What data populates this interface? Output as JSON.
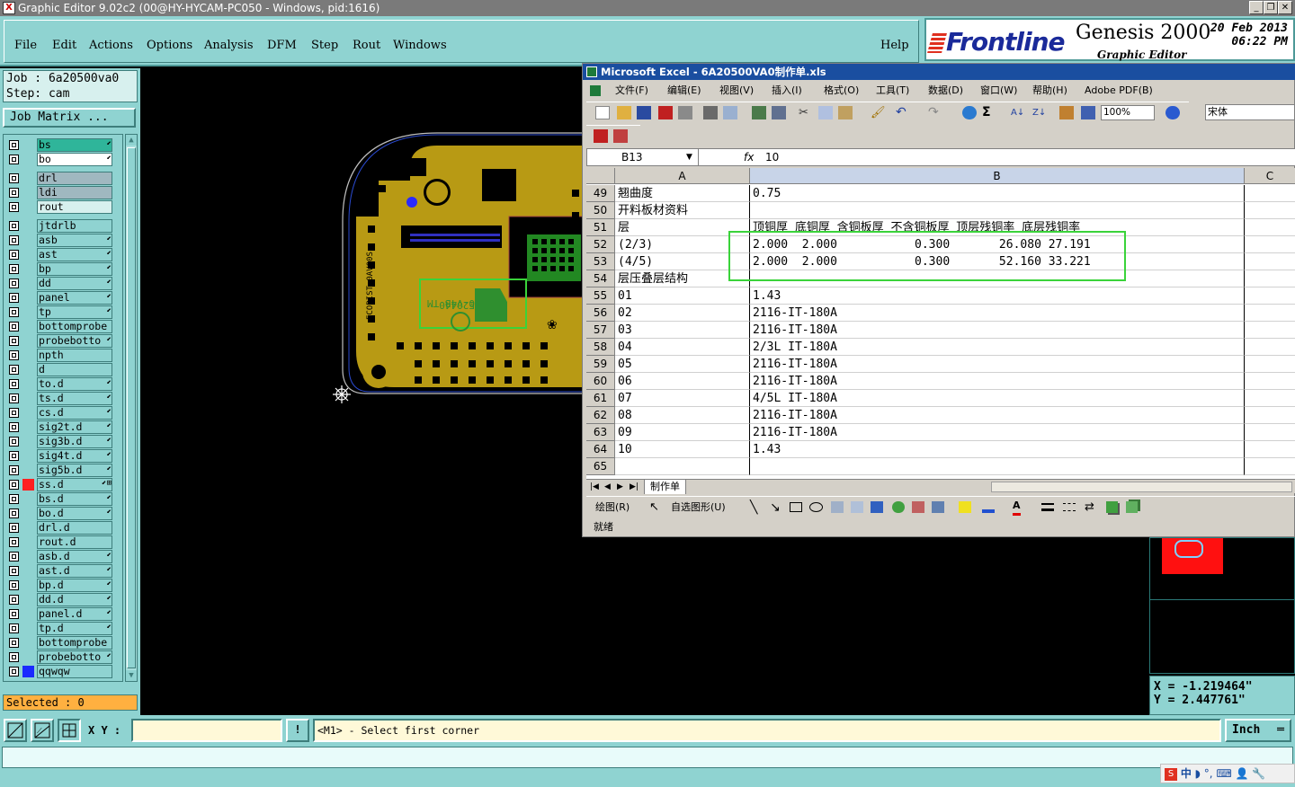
{
  "window": {
    "title": "Graphic Editor 9.02c2 (00@HY-HYCAM-PC050 - Windows, pid:1616)"
  },
  "menu": [
    {
      "label": "File"
    },
    {
      "label": "Edit"
    },
    {
      "label": "Actions"
    },
    {
      "label": "Options"
    },
    {
      "label": "Analysis"
    },
    {
      "label": "DFM"
    },
    {
      "label": "Step"
    },
    {
      "label": "Rout"
    },
    {
      "label": "Windows"
    },
    {
      "label": "Help"
    }
  ],
  "brand": {
    "logo": "Frontline",
    "product": "Genesis 2000",
    "subtitle": "Graphic Editor",
    "date": "20 Feb 2013",
    "time": "06:22 PM"
  },
  "job": {
    "job_line": "Job : 6a20500va0",
    "step_line": "Step: cam",
    "matrix_button": "Job Matrix ...",
    "selected": "Selected : 0"
  },
  "layers": [
    {
      "name": "bs",
      "color": "#2fb59a",
      "tag": "⬋"
    },
    {
      "name": "bo",
      "color": "#ffffff",
      "tag": "⬋"
    },
    {
      "name": "drl",
      "color": "#a0b8c0",
      "tag": ""
    },
    {
      "name": "ldi",
      "color": "#a0b8c0",
      "tag": ""
    },
    {
      "name": "rout",
      "color": "#d7f0ee",
      "tag": ""
    },
    {
      "name": "jtdrlb",
      "color": "",
      "tag": ""
    },
    {
      "name": "asb",
      "color": "",
      "tag": "⬋"
    },
    {
      "name": "ast",
      "color": "",
      "tag": "⬋"
    },
    {
      "name": "bp",
      "color": "",
      "tag": "⬋"
    },
    {
      "name": "dd",
      "color": "",
      "tag": "⬋"
    },
    {
      "name": "panel",
      "color": "",
      "tag": "⬋"
    },
    {
      "name": "tp",
      "color": "",
      "tag": "⬋"
    },
    {
      "name": "bottomprobe",
      "color": "",
      "tag": ""
    },
    {
      "name": "probebotto",
      "color": "",
      "tag": "⬋"
    },
    {
      "name": "npth",
      "color": "",
      "tag": ""
    },
    {
      "name": "d",
      "color": "",
      "tag": ""
    },
    {
      "name": "to.d",
      "color": "",
      "tag": "⬋"
    },
    {
      "name": "ts.d",
      "color": "",
      "tag": "⬋"
    },
    {
      "name": "cs.d",
      "color": "",
      "tag": "⬋"
    },
    {
      "name": "sig2t.d",
      "color": "",
      "tag": "⬋"
    },
    {
      "name": "sig3b.d",
      "color": "",
      "tag": "⬋"
    },
    {
      "name": "sig4t.d",
      "color": "",
      "tag": "⬋"
    },
    {
      "name": "sig5b.d",
      "color": "",
      "tag": "⬋"
    },
    {
      "name": "ss.d",
      "color": "",
      "tag": "⬋⊞",
      "swatch": "#ff2020"
    },
    {
      "name": "bs.d",
      "color": "",
      "tag": "⬋"
    },
    {
      "name": "bo.d",
      "color": "",
      "tag": "⬋"
    },
    {
      "name": "drl.d",
      "color": "",
      "tag": ""
    },
    {
      "name": "rout.d",
      "color": "",
      "tag": ""
    },
    {
      "name": "asb.d",
      "color": "",
      "tag": "⬋"
    },
    {
      "name": "ast.d",
      "color": "",
      "tag": "⬋"
    },
    {
      "name": "bp.d",
      "color": "",
      "tag": "⬋"
    },
    {
      "name": "dd.d",
      "color": "",
      "tag": "⬋"
    },
    {
      "name": "panel.d",
      "color": "",
      "tag": "⬋"
    },
    {
      "name": "tp.d",
      "color": "",
      "tag": "⬋"
    },
    {
      "name": "bottomprobe",
      "color": "",
      "tag": ""
    },
    {
      "name": "probebotto",
      "color": "",
      "tag": "⬋"
    },
    {
      "name": "qqwqw",
      "color": "",
      "tag": "",
      "swatch": "#1a2aff"
    }
  ],
  "excel": {
    "title": "Microsoft Excel - 6A20500VA0制作单.xls",
    "menu": [
      "文件(F)",
      "编辑(E)",
      "视图(V)",
      "插入(I)",
      "格式(O)",
      "工具(T)",
      "数据(D)",
      "窗口(W)",
      "帮助(H)",
      "Adobe PDF(B)"
    ],
    "zoom": "100%",
    "font": "宋体",
    "name_box": "B13",
    "fx": "fx",
    "formula": "10",
    "columns": [
      "A",
      "B",
      "C"
    ],
    "rows": [
      {
        "num": "49",
        "a": "翘曲度",
        "b": "0.75"
      },
      {
        "num": "50",
        "a": "开料板材资料",
        "b": ""
      },
      {
        "num": "51",
        "a": "层",
        "b": "顶铜厚 底铜厚 含铜板厚 不含铜板厚 顶层残铜率 底层残铜率"
      },
      {
        "num": "52",
        "a": "(2/3)",
        "b": "2.000  2.000           0.300       26.080 27.191"
      },
      {
        "num": "53",
        "a": "(4/5)",
        "b": "2.000  2.000           0.300       52.160 33.221"
      },
      {
        "num": "54",
        "a": "层压叠层结构",
        "b": ""
      },
      {
        "num": "55",
        "a": "01",
        "b": "1.43"
      },
      {
        "num": "56",
        "a": "02",
        "b": "2116-IT-180A"
      },
      {
        "num": "57",
        "a": "03",
        "b": "2116-IT-180A"
      },
      {
        "num": "58",
        "a": "04",
        "b": "2/3L IT-180A"
      },
      {
        "num": "59",
        "a": "05",
        "b": "2116-IT-180A"
      },
      {
        "num": "60",
        "a": "06",
        "b": "2116-IT-180A"
      },
      {
        "num": "61",
        "a": "07",
        "b": "4/5L IT-180A"
      },
      {
        "num": "62",
        "a": "08",
        "b": "2116-IT-180A"
      },
      {
        "num": "63",
        "a": "09",
        "b": "2116-IT-180A"
      },
      {
        "num": "64",
        "a": "10",
        "b": "1.43"
      },
      {
        "num": "65",
        "a": "",
        "b": ""
      }
    ],
    "sheet_tab": "制作单",
    "draw_label": "绘图(R)",
    "autoshape_label": "自选图形(U)",
    "status": "就绪"
  },
  "coords": {
    "x": "X = -1.219464\"",
    "y": "Y = 2.447761\""
  },
  "bottom": {
    "xy_label": "X Y :",
    "message": "<M1> - Select first corner",
    "units": "Inch",
    "ime": "中"
  },
  "colors": {
    "panel": "#8fd3d1",
    "copper": "#b89a14",
    "board_outline": "#c0c0c0",
    "highlight_box": "#3ad33a"
  }
}
